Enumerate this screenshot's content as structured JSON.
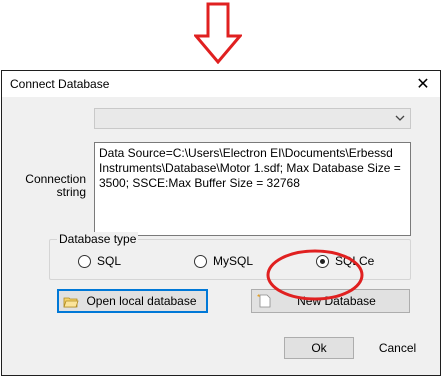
{
  "dialog": {
    "title": "Connect Database",
    "close_icon": "close-icon"
  },
  "connection": {
    "label_line1": "Connection",
    "label_line2": "string",
    "value": "Data Source=C:\\Users\\Electron EI\\Documents\\Erbessd Instruments\\Database\\Motor 1.sdf; Max Database Size = 3500; SSCE:Max Buffer Size = 32768"
  },
  "database_type": {
    "title": "Database type",
    "options": [
      {
        "label": "SQL",
        "checked": false
      },
      {
        "label": "MySQL",
        "checked": false
      },
      {
        "label": "SQLCe",
        "checked": true
      }
    ]
  },
  "buttons": {
    "open_local": "Open local database",
    "new_database": "New Database",
    "ok": "Ok",
    "cancel": "Cancel"
  },
  "annotation": {
    "arrow_color": "#e02020",
    "circle_color": "#e02020"
  }
}
